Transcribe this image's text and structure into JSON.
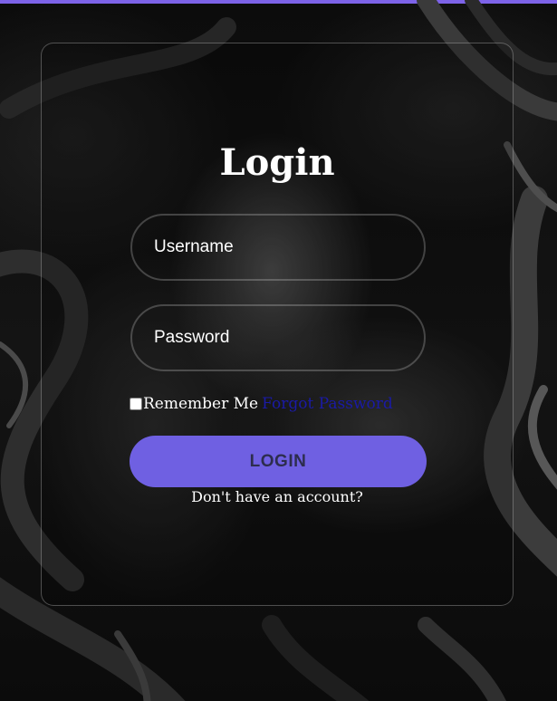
{
  "theme": {
    "accent": "#6f60e2",
    "top_strip": "#7d63e8",
    "link_color": "#1a1aa6",
    "background": "#0c0c0c"
  },
  "login_form": {
    "title": "Login",
    "username_placeholder": "Username",
    "password_placeholder": "Password",
    "remember_label": "Remember Me",
    "remember_checked": false,
    "forgot_password_link": "Forgot Password",
    "submit_label": "LOGIN",
    "signup_prompt": "Don't have an account?"
  }
}
